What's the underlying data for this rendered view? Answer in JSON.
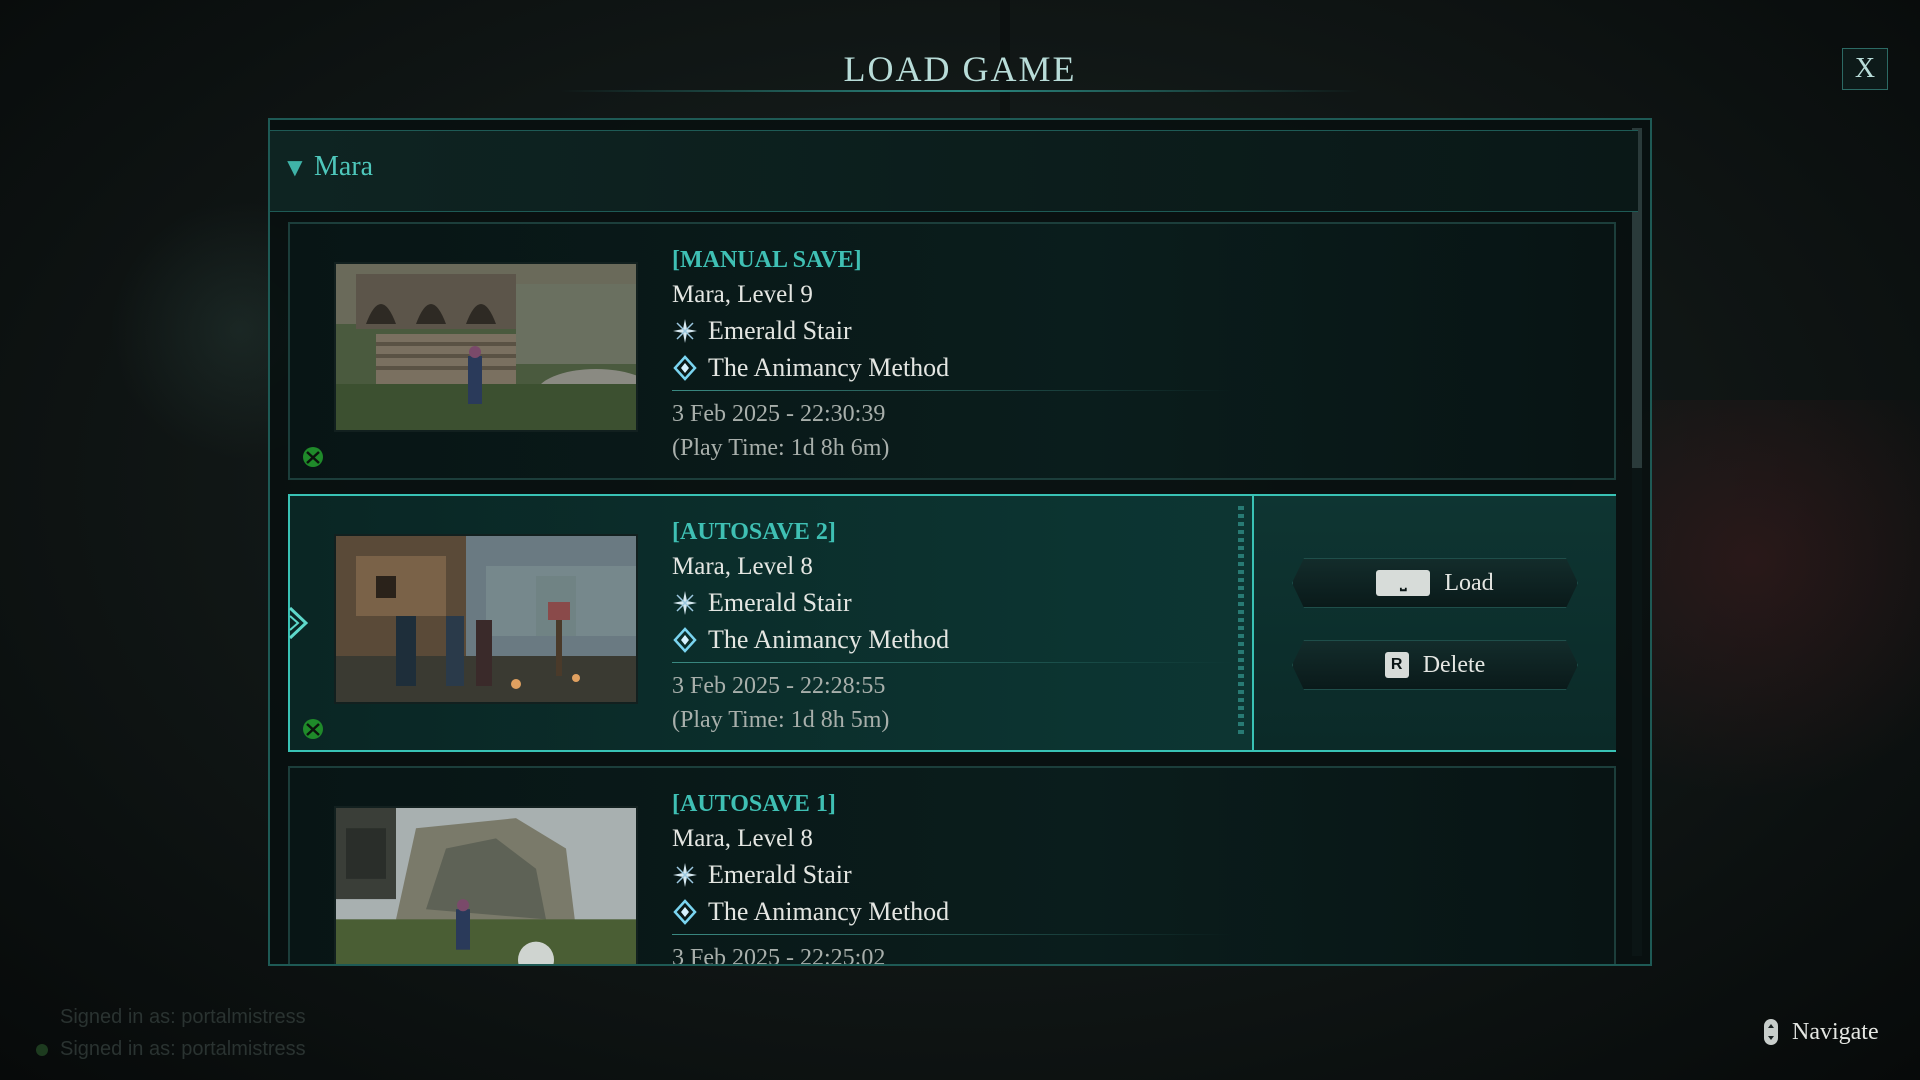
{
  "screen": {
    "title": "LOAD GAME",
    "close_label": "X"
  },
  "group": {
    "name": "Mara"
  },
  "saves": [
    {
      "type": "[MANUAL SAVE]",
      "character": "Mara, Level 9",
      "location": "Emerald Stair",
      "quest": "The Animancy Method",
      "date": "3 Feb 2025 - 22:30:39",
      "playtime": "(Play Time: 1d 8h 6m)"
    },
    {
      "type": "[AUTOSAVE 2]",
      "character": "Mara, Level 8",
      "location": "Emerald Stair",
      "quest": "The Animancy Method",
      "date": "3 Feb 2025 - 22:28:55",
      "playtime": "(Play Time: 1d 8h 5m)"
    },
    {
      "type": "[AUTOSAVE 1]",
      "character": "Mara, Level 8",
      "location": "Emerald Stair",
      "quest": "The Animancy Method",
      "date": "3 Feb 2025 - 22:25:02"
    }
  ],
  "actions": {
    "load_label": "Load",
    "delete_label": "Delete",
    "delete_key": "R"
  },
  "footer": {
    "signin_1": "Signed in as: portalmistress",
    "signin_2": "Signed in as: portalmistress",
    "navigate_label": "Navigate"
  },
  "colors": {
    "accent": "#3fc0b4",
    "selected_border": "#39c2b5"
  },
  "icons": {
    "location": "compass-star-icon",
    "quest": "quest-diamond-icon",
    "platform": "xbox-icon",
    "close": "close-icon",
    "navigate": "left-stick-icon"
  }
}
